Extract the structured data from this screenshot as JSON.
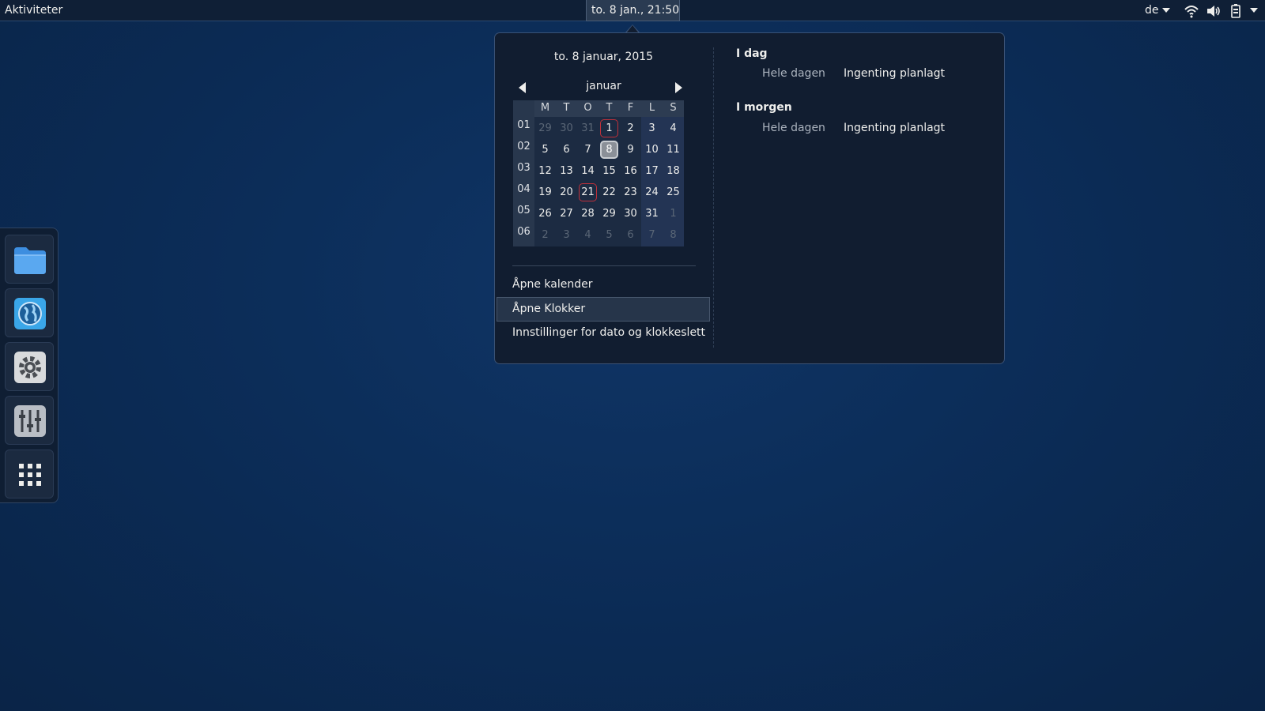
{
  "topbar": {
    "activities": "Aktiviteter",
    "clock": "to.  8 jan., 21:50",
    "language": "de",
    "icons": [
      "wifi-icon",
      "volume-icon",
      "battery-icon"
    ]
  },
  "calendar": {
    "date_header": "to.  8 januar, 2015",
    "month": "januar",
    "day_headers": [
      "M",
      "T",
      "O",
      "T",
      "F",
      "L",
      "S"
    ],
    "week_numbers": [
      "01",
      "02",
      "03",
      "04",
      "05",
      "06"
    ],
    "weeks": [
      [
        "29",
        "30",
        "31",
        "1",
        "2",
        "3",
        "4"
      ],
      [
        "5",
        "6",
        "7",
        "8",
        "9",
        "10",
        "11"
      ],
      [
        "12",
        "13",
        "14",
        "15",
        "16",
        "17",
        "18"
      ],
      [
        "19",
        "20",
        "21",
        "22",
        "23",
        "24",
        "25"
      ],
      [
        "26",
        "27",
        "28",
        "29",
        "30",
        "31",
        "1"
      ],
      [
        "2",
        "3",
        "4",
        "5",
        "6",
        "7",
        "8"
      ]
    ],
    "selected_day": "8",
    "marked_days": [
      "1",
      "21"
    ]
  },
  "menu": {
    "open_calendar": "Åpne kalender",
    "open_clocks": "Åpne Klokker",
    "date_settings": "Innstillinger for dato og klokkeslett"
  },
  "events": {
    "today_title": "I dag",
    "today_time": "Hele dagen",
    "today_text": "Ingenting planlagt",
    "tomorrow_title": "I morgen",
    "tomorrow_time": "Hele dagen",
    "tomorrow_text": "Ingenting planlagt"
  },
  "dash": {
    "items": [
      "folder-icon",
      "globe-icon",
      "settings-gear-icon",
      "mixer-sliders-icon",
      "app-grid-icon"
    ]
  },
  "colors": {
    "desktop": "#0b2b55",
    "topbar": "#0f1f36",
    "popup": "#111d30",
    "holiday_marker": "#c0303a"
  }
}
